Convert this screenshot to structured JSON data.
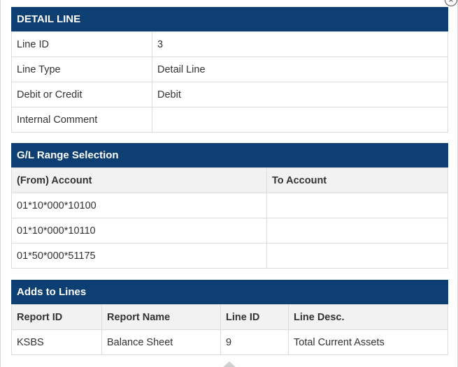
{
  "close_glyph": "×",
  "detail": {
    "title": "DETAIL LINE",
    "rows": [
      {
        "label": "Line ID",
        "value": "3"
      },
      {
        "label": "Line Type",
        "value": "Detail Line"
      },
      {
        "label": "Debit or Credit",
        "value": "Debit"
      },
      {
        "label": "Internal Comment",
        "value": ""
      }
    ]
  },
  "gl_range": {
    "title": "G/L Range Selection",
    "headers": [
      "(From) Account",
      "To Account"
    ],
    "rows": [
      [
        "01*10*000*10100",
        ""
      ],
      [
        "01*10*000*10110",
        ""
      ],
      [
        "01*50*000*51175",
        ""
      ]
    ]
  },
  "adds_to": {
    "title": "Adds to Lines",
    "headers": [
      "Report ID",
      "Report Name",
      "Line ID",
      "Line Desc."
    ],
    "rows": [
      [
        "KSBS",
        "Balance Sheet",
        "9",
        "Total Current Assets"
      ]
    ]
  }
}
